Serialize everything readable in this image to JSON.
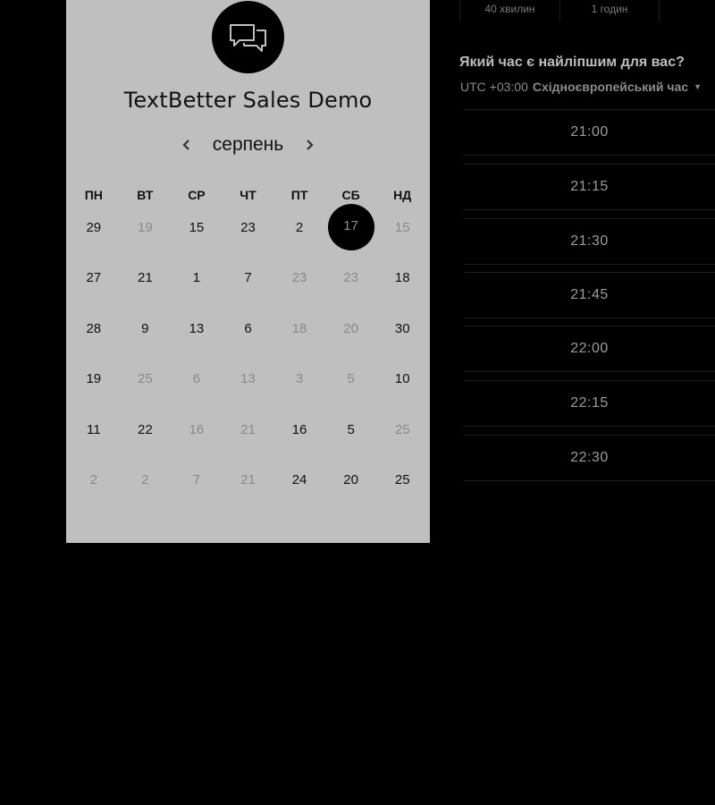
{
  "event": {
    "title": "TextBetter Sales Demo",
    "logo_icon": "chat-bubbles-icon"
  },
  "calendar": {
    "month": "серпень",
    "prev_icon": "chevron-left-icon",
    "next_icon": "chevron-right-icon",
    "weekdays": [
      "ПН",
      "ВТ",
      "СР",
      "ЧТ",
      "ПТ",
      "СБ",
      "НД"
    ],
    "weeks": [
      [
        {
          "d": "29",
          "muted": false
        },
        {
          "d": "19",
          "muted": true
        },
        {
          "d": "15",
          "muted": false
        },
        {
          "d": "23",
          "muted": false
        },
        {
          "d": "2",
          "muted": false
        },
        {
          "d": "17",
          "muted": true,
          "selected": true
        },
        {
          "d": "15",
          "muted": true
        }
      ],
      [
        {
          "d": "27",
          "muted": false
        },
        {
          "d": "21",
          "muted": false
        },
        {
          "d": "1",
          "muted": false
        },
        {
          "d": "7",
          "muted": false
        },
        {
          "d": "23",
          "muted": true
        },
        {
          "d": "23",
          "muted": true
        },
        {
          "d": "18",
          "muted": false
        }
      ],
      [
        {
          "d": "28",
          "muted": false
        },
        {
          "d": "9",
          "muted": false
        },
        {
          "d": "13",
          "muted": false
        },
        {
          "d": "6",
          "muted": false
        },
        {
          "d": "18",
          "muted": true
        },
        {
          "d": "20",
          "muted": true
        },
        {
          "d": "30",
          "muted": false
        }
      ],
      [
        {
          "d": "19",
          "muted": false
        },
        {
          "d": "25",
          "muted": true
        },
        {
          "d": "6",
          "muted": true
        },
        {
          "d": "13",
          "muted": true
        },
        {
          "d": "3",
          "muted": true
        },
        {
          "d": "5",
          "muted": true
        },
        {
          "d": "10",
          "muted": false
        }
      ],
      [
        {
          "d": "11",
          "muted": false
        },
        {
          "d": "22",
          "muted": false
        },
        {
          "d": "16",
          "muted": true
        },
        {
          "d": "21",
          "muted": true
        },
        {
          "d": "16",
          "muted": false
        },
        {
          "d": "5",
          "muted": false
        },
        {
          "d": "25",
          "muted": true
        }
      ],
      [
        {
          "d": "2",
          "muted": true
        },
        {
          "d": "2",
          "muted": true
        },
        {
          "d": "7",
          "muted": true
        },
        {
          "d": "21",
          "muted": true
        },
        {
          "d": "24",
          "muted": false
        },
        {
          "d": "20",
          "muted": false
        },
        {
          "d": "25",
          "muted": false
        }
      ]
    ]
  },
  "durations": [
    "40 хвилин",
    "1 годин"
  ],
  "scheduler": {
    "question": "Який час є найліпшим для вас?",
    "tz_offset": "UTC +03:00",
    "tz_name": "Східноєвропейський час",
    "tz_caret_icon": "caret-down-icon"
  },
  "time_slots": [
    "21:00",
    "21:15",
    "21:30",
    "21:45",
    "22:00",
    "22:15",
    "22:30"
  ]
}
